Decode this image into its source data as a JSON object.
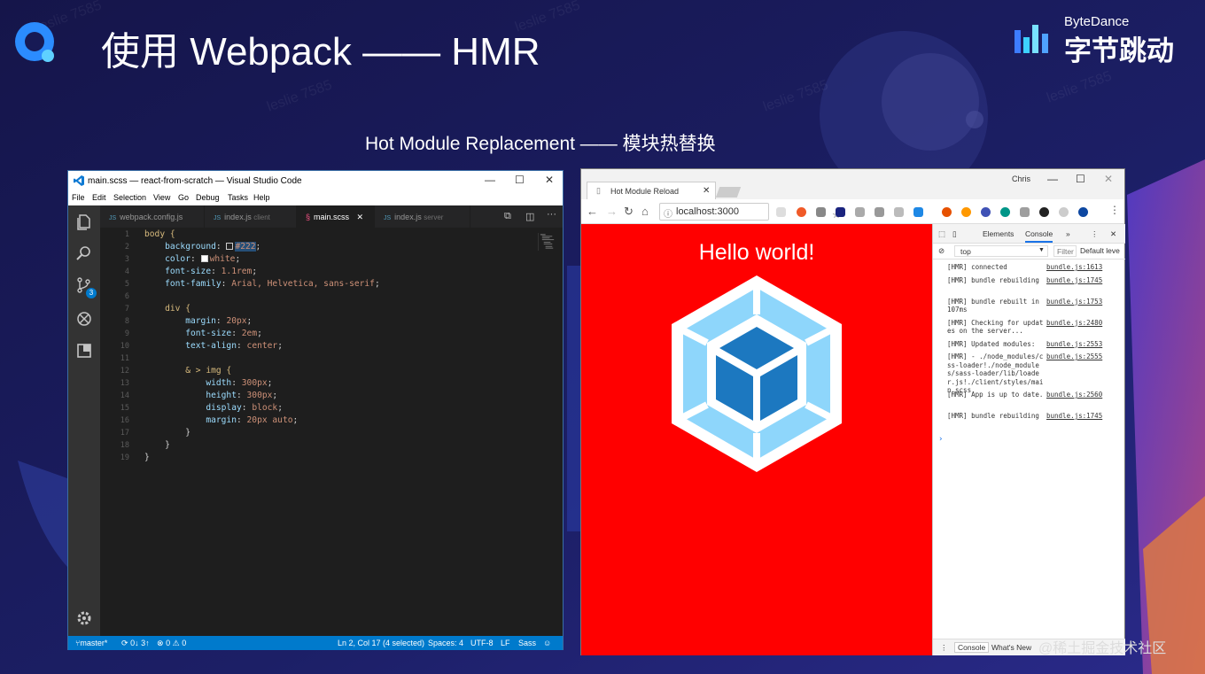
{
  "slide": {
    "title": "使用 Webpack —— HMR",
    "subtitle": "Hot Module Replacement —— 模块热替换",
    "brand_en": "ByteDance",
    "brand_cn": "字节跳动",
    "watermark": "leslie 7585",
    "footer_watermark": "@稀土掘金技术社区"
  },
  "vscode": {
    "window_title": "main.scss — react-from-scratch — Visual Studio Code",
    "menu": [
      "File",
      "Edit",
      "Selection",
      "View",
      "Go",
      "Debug",
      "Tasks",
      "Help"
    ],
    "tabs": [
      {
        "icon": "JS",
        "label": "webpack.config.js",
        "sub": ""
      },
      {
        "icon": "JS",
        "label": "index.js",
        "sub": "client"
      },
      {
        "icon": "scss",
        "label": "main.scss",
        "sub": ""
      },
      {
        "icon": "JS",
        "label": "index.js",
        "sub": "server"
      }
    ],
    "scm_badge": "3",
    "line_numbers": [
      "1",
      "2",
      "3",
      "4",
      "5",
      "6",
      "7",
      "8",
      "9",
      "10",
      "11",
      "12",
      "13",
      "14",
      "15",
      "16",
      "17",
      "18",
      "19"
    ],
    "code": {
      "l1_sel": "body {",
      "l2_prop": "background",
      "l2_val": "#222",
      "l3_prop": "color",
      "l3_val": "white",
      "l4_prop": "font-size",
      "l4_val": "1.1rem",
      "l5_prop": "font-family",
      "l5_val": "Arial, Helvetica, sans-serif",
      "l7_sel": "div {",
      "l8_prop": "margin",
      "l8_val": "20px",
      "l9_prop": "font-size",
      "l9_val": "2em",
      "l10_prop": "text-align",
      "l10_val": "center",
      "l12_sel": "& > img {",
      "l13_prop": "width",
      "l13_val": "300px",
      "l14_prop": "height",
      "l14_val": "300px",
      "l15_prop": "display",
      "l15_val": "block",
      "l16_prop": "margin",
      "l16_val": "20px auto",
      "close": "}"
    },
    "status": {
      "branch": "master*",
      "sync": "0↓ 3↑",
      "problems": "0",
      "warnings": "0",
      "position": "Ln 2, Col 17 (4 selected)",
      "spaces": "Spaces: 4",
      "encoding": "UTF-8",
      "eol": "LF",
      "language": "Sass"
    }
  },
  "browser": {
    "tab_title": "Hot Module Reload",
    "user_label": "Chris",
    "url": "localhost:3000",
    "page_heading": "Hello world!",
    "page_bg": "#ff0000",
    "devtools": {
      "tabs": [
        "Elements",
        "Console"
      ],
      "more": "»",
      "context": "top",
      "filter_placeholder": "Filter",
      "levels": "Default leve",
      "logs": [
        {
          "msg": "[HMR] connected",
          "src": "bundle.js:1613"
        },
        {
          "msg": "[HMR] bundle rebuilding",
          "src": "bundle.js:1745"
        },
        {
          "msg": "[HMR] bundle rebuilt in 107ms",
          "src": "bundle.js:1753"
        },
        {
          "msg": "[HMR] Checking for updates on the server...",
          "src": "bundle.js:2480"
        },
        {
          "msg": "[HMR] Updated modules:",
          "src": "bundle.js:2553"
        },
        {
          "msg": "[HMR] - ./node_modules/css-loader!./node_modules/sass-loader/lib/loader.js!./client/styles/main.scss",
          "src": "bundle.js:2555"
        },
        {
          "msg": "[HMR] App is up to date.",
          "src": "bundle.js:2560"
        },
        {
          "msg": "[HMR] bundle rebuilding",
          "src": "bundle.js:1745"
        }
      ],
      "prompt": "›",
      "drawer_tabs": [
        "Console",
        "What's New"
      ]
    }
  }
}
